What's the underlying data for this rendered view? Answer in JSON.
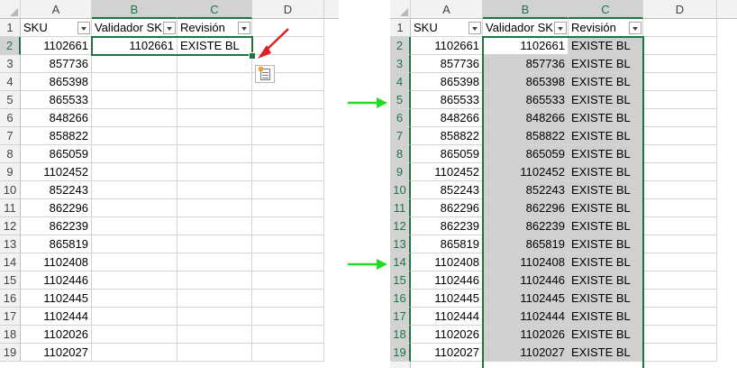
{
  "col_headers": [
    "A",
    "B",
    "C",
    "D"
  ],
  "table_headers": [
    "SKU",
    "Validador SK",
    "Revisión"
  ],
  "left_rows": [
    {
      "row": "1"
    },
    {
      "row": "2",
      "sku": "1102661",
      "validador": "1102661",
      "revision": "EXISTE BL"
    },
    {
      "row": "3",
      "sku": "857736"
    },
    {
      "row": "4",
      "sku": "865398"
    },
    {
      "row": "5",
      "sku": "865533"
    },
    {
      "row": "6",
      "sku": "848266"
    },
    {
      "row": "7",
      "sku": "858822"
    },
    {
      "row": "8",
      "sku": "865059"
    },
    {
      "row": "9",
      "sku": "1102452"
    },
    {
      "row": "10",
      "sku": "852243"
    },
    {
      "row": "11",
      "sku": "862296"
    },
    {
      "row": "12",
      "sku": "862239"
    },
    {
      "row": "13",
      "sku": "865819"
    },
    {
      "row": "14",
      "sku": "1102408"
    },
    {
      "row": "15",
      "sku": "1102446"
    },
    {
      "row": "16",
      "sku": "1102445"
    },
    {
      "row": "17",
      "sku": "1102444"
    },
    {
      "row": "18",
      "sku": "1102026"
    },
    {
      "row": "19",
      "sku": "1102027"
    }
  ],
  "right_rows": [
    {
      "row": "1"
    },
    {
      "row": "2",
      "sku": "1102661",
      "validador": "1102661",
      "revision": "EXISTE BL"
    },
    {
      "row": "3",
      "sku": "857736",
      "validador": "857736",
      "revision": "EXISTE BL"
    },
    {
      "row": "4",
      "sku": "865398",
      "validador": "865398",
      "revision": "EXISTE BL"
    },
    {
      "row": "5",
      "sku": "865533",
      "validador": "865533",
      "revision": "EXISTE BL"
    },
    {
      "row": "6",
      "sku": "848266",
      "validador": "848266",
      "revision": "EXISTE BL"
    },
    {
      "row": "7",
      "sku": "858822",
      "validador": "858822",
      "revision": "EXISTE BL"
    },
    {
      "row": "8",
      "sku": "865059",
      "validador": "865059",
      "revision": "EXISTE BL"
    },
    {
      "row": "9",
      "sku": "1102452",
      "validador": "1102452",
      "revision": "EXISTE BL"
    },
    {
      "row": "10",
      "sku": "852243",
      "validador": "852243",
      "revision": "EXISTE BL"
    },
    {
      "row": "11",
      "sku": "862296",
      "validador": "862296",
      "revision": "EXISTE BL"
    },
    {
      "row": "12",
      "sku": "862239",
      "validador": "862239",
      "revision": "EXISTE BL"
    },
    {
      "row": "13",
      "sku": "865819",
      "validador": "865819",
      "revision": "EXISTE BL"
    },
    {
      "row": "14",
      "sku": "1102408",
      "validador": "1102408",
      "revision": "EXISTE BL"
    },
    {
      "row": "15",
      "sku": "1102446",
      "validador": "1102446",
      "revision": "EXISTE BL"
    },
    {
      "row": "16",
      "sku": "1102445",
      "validador": "1102445",
      "revision": "EXISTE BL"
    },
    {
      "row": "17",
      "sku": "1102444",
      "validador": "1102444",
      "revision": "EXISTE BL"
    },
    {
      "row": "18",
      "sku": "1102026",
      "validador": "1102026",
      "revision": "EXISTE BL"
    },
    {
      "row": "19",
      "sku": "1102027",
      "validador": "1102027",
      "revision": "EXISTE BL"
    }
  ],
  "colors": {
    "selection": "#217346",
    "filled_cell": "#d0d0d0",
    "red_arrow": "#e02020",
    "green_arrow": "#22dd22"
  },
  "icons": {
    "quick_analysis": "quick-analysis-icon",
    "filter": "filter-dropdown-icon",
    "fill_handle": "fill-handle"
  }
}
